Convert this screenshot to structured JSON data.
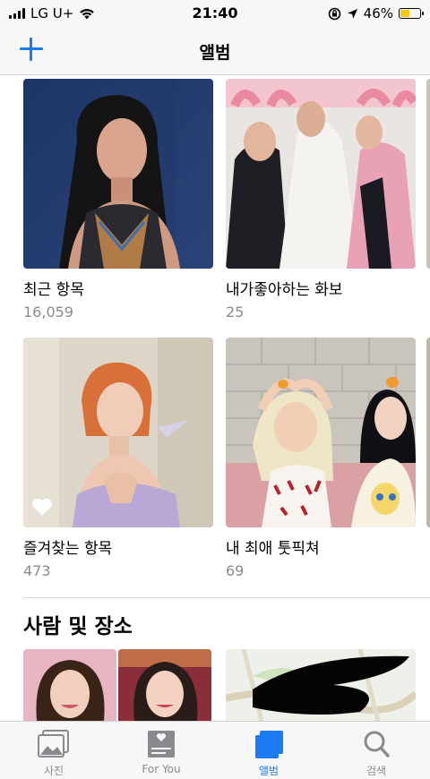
{
  "status_bar": {
    "carrier": "LG U+",
    "time": "21:40",
    "battery": "46%",
    "battery_level": 0.46
  },
  "nav": {
    "title": "앨범",
    "add_icon": "plus-icon"
  },
  "albums": [
    {
      "title": "최근 항목",
      "count": "16,059"
    },
    {
      "title": "내가좋아하는 화보",
      "count": "25"
    },
    {
      "title": "즐겨찾는 항목",
      "count": "473"
    },
    {
      "title": "내 최애 툿픽쳐",
      "count": "69"
    }
  ],
  "people_places": {
    "title": "사람 및 장소"
  },
  "tabs": [
    {
      "label": "사진",
      "icon": "photos-icon"
    },
    {
      "label": "For You",
      "icon": "for-you-icon"
    },
    {
      "label": "앨범",
      "icon": "albums-icon",
      "active": true
    },
    {
      "label": "검색",
      "icon": "search-icon"
    }
  ],
  "colors": {
    "accent": "#1a7cf0",
    "secondary_text": "#8a8a8e",
    "battery": "#f5c518"
  }
}
